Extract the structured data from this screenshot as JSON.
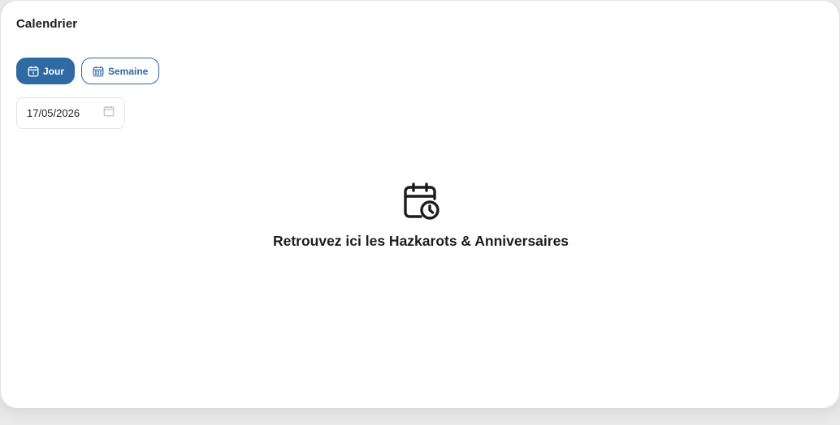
{
  "header": {
    "title": "Calendrier"
  },
  "view_toggle": {
    "day_label": "Jour",
    "week_label": "Semaine",
    "selected": "Jour"
  },
  "date_picker": {
    "value": "17/05/2026"
  },
  "empty_state": {
    "message": "Retrouvez ici les Hazkarots & Anniversaires",
    "icon": "calendar-clock-icon"
  },
  "colors": {
    "accent": "#2f6aa3",
    "text": "#1d1d1f",
    "background": "#ffffff"
  }
}
